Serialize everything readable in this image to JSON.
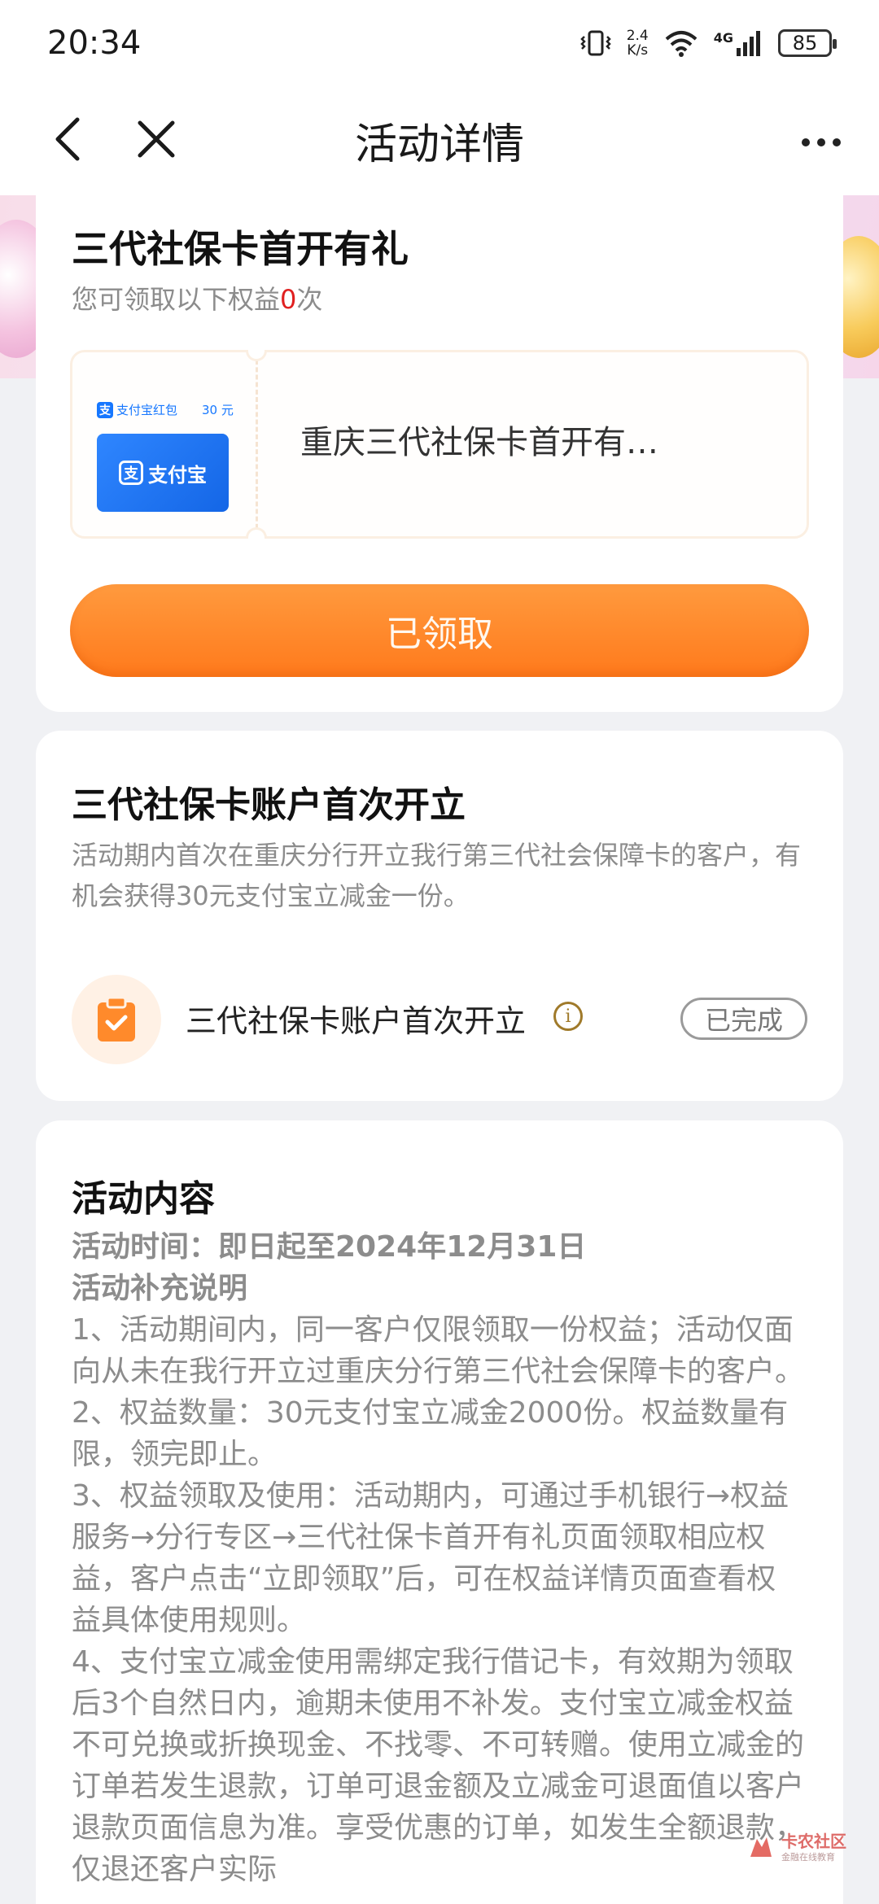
{
  "status_bar": {
    "time": "20:34",
    "speed": "2.4",
    "speed_unit": "K/s",
    "network": "4G",
    "battery": "85"
  },
  "nav": {
    "title": "活动详情",
    "back_icon": "chevron-left-icon",
    "close_icon": "close-icon",
    "more_icon": "more-dots-icon"
  },
  "reward_card": {
    "title": "三代社保卡首开有礼",
    "subtitle_prefix": "您可领取以下权益",
    "subtitle_count": "0",
    "subtitle_suffix": "次",
    "coupon": {
      "brand": "支付宝红包",
      "amount": "30 元",
      "card_label": "支付宝",
      "name": "重庆三代社保卡首开有…"
    },
    "button_label": "已领取"
  },
  "task_card": {
    "title": "三代社保卡账户首次开立",
    "description": "活动期内首次在重庆分行开立我行第三代社会保障卡的客户，有机会获得30元支付宝立减金一份。",
    "task": {
      "label": "三代社保卡账户首次开立",
      "status": "已完成"
    }
  },
  "content_card": {
    "title": "活动内容",
    "time_line": "活动时间：即日起至2024年12月31日",
    "supplement_heading": "活动补充说明",
    "paragraphs": [
      "1、活动期间内，同一客户仅限领取一份权益；活动仅面向从未在我行开立过重庆分行第三代社会保障卡的客户。",
      "2、权益数量：30元支付宝立减金2000份。权益数量有限，领完即止。",
      "3、权益领取及使用：活动期内，可通过手机银行→权益服务→分行专区→三代社保卡首开有礼页面领取相应权益，客户点击“立即领取”后，可在权益详情页面查看权益具体使用规则。",
      "4、支付宝立减金使用需绑定我行借记卡，有效期为领取后3个自然日内，逾期未使用不补发。支付宝立减金权益不可兑换或折换现金、不找零、不可转赠。使用立减金的订单若发生退款，订单可退金额及立减金可退面值以客户退款页面信息为准。享受优惠的订单，如发生全额退款，仅退还客户实际"
    ]
  },
  "watermark": {
    "text": "卡农社区",
    "sub": "金融在线教育"
  },
  "colors": {
    "accent_orange": "#ff8a2b",
    "alipay_blue": "#1677ff",
    "highlight_red": "#e02020"
  }
}
